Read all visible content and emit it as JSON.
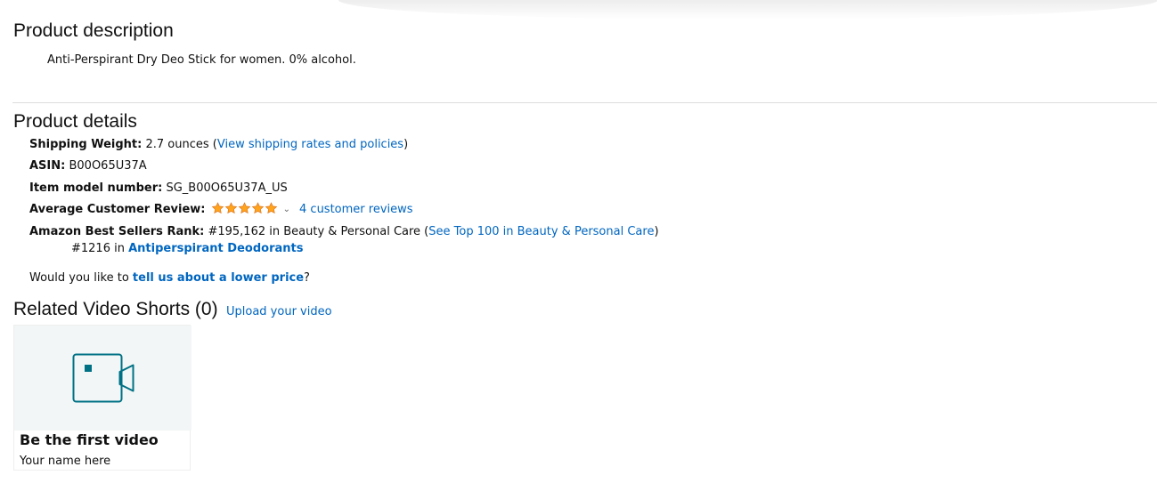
{
  "description": {
    "heading": "Product description",
    "text": "Anti-Perspirant Dry Deo Stick for women. 0% alcohol."
  },
  "details": {
    "heading": "Product details",
    "shipping": {
      "label": "Shipping Weight:",
      "value": "2.7 ounces (",
      "link": "View shipping rates and policies",
      "suffix": ")"
    },
    "asin": {
      "label": "ASIN:",
      "value": "B00O65U37A"
    },
    "model": {
      "label": "Item model number:",
      "value": "SG_B00O65U37A_US"
    },
    "review": {
      "label": "Average Customer Review:",
      "rating": 5,
      "reviews_link": "4 customer reviews"
    },
    "rank": {
      "label": "Amazon Best Sellers Rank:",
      "value": "#195,162 in Beauty & Personal Care (",
      "link": "See Top 100 in Beauty & Personal Care",
      "suffix": ")",
      "sub_prefix": "#1216 in ",
      "sub_link": "Antiperspirant Deodorants"
    },
    "lower_price": {
      "prefix": "Would you like to ",
      "link": "tell us about a lower price",
      "suffix": "?"
    }
  },
  "videos": {
    "heading": "Related Video Shorts (0)",
    "upload_link": "Upload your video",
    "card": {
      "icon": "video-camera-icon",
      "title": "Be the first video",
      "subtitle": "Your name here"
    }
  },
  "colors": {
    "link": "#0066c0",
    "star": "#ffa41c",
    "teal": "#007185",
    "thumb_bg": "#f2f6f6"
  }
}
